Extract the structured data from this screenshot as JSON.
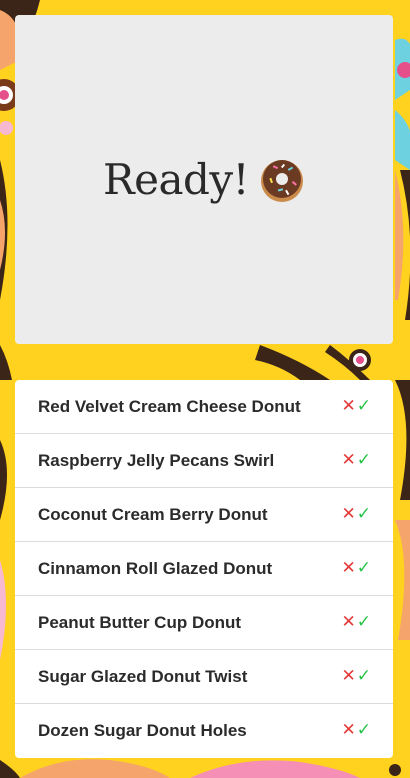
{
  "status": {
    "text": "Ready!",
    "icon": "donut-icon"
  },
  "items": [
    {
      "label": "Red Velvet Cream Cheese Donut",
      "reject": "✕",
      "accept": "✓"
    },
    {
      "label": "Raspberry Jelly Pecans Swirl",
      "reject": "✕",
      "accept": "✓"
    },
    {
      "label": "Coconut Cream Berry Donut",
      "reject": "✕",
      "accept": "✓"
    },
    {
      "label": "Cinnamon Roll Glazed Donut",
      "reject": "✕",
      "accept": "✓"
    },
    {
      "label": "Peanut Butter Cup Donut",
      "reject": "✕",
      "accept": "✓"
    },
    {
      "label": "Sugar Glazed Donut Twist",
      "reject": "✕",
      "accept": "✓"
    },
    {
      "label": "Dozen Sugar Donut Holes",
      "reject": "✕",
      "accept": "✓"
    }
  ],
  "colors": {
    "background": "#ffd21f",
    "card": "#ececec",
    "reject": "#e53a3a",
    "accept": "#28c34a"
  }
}
